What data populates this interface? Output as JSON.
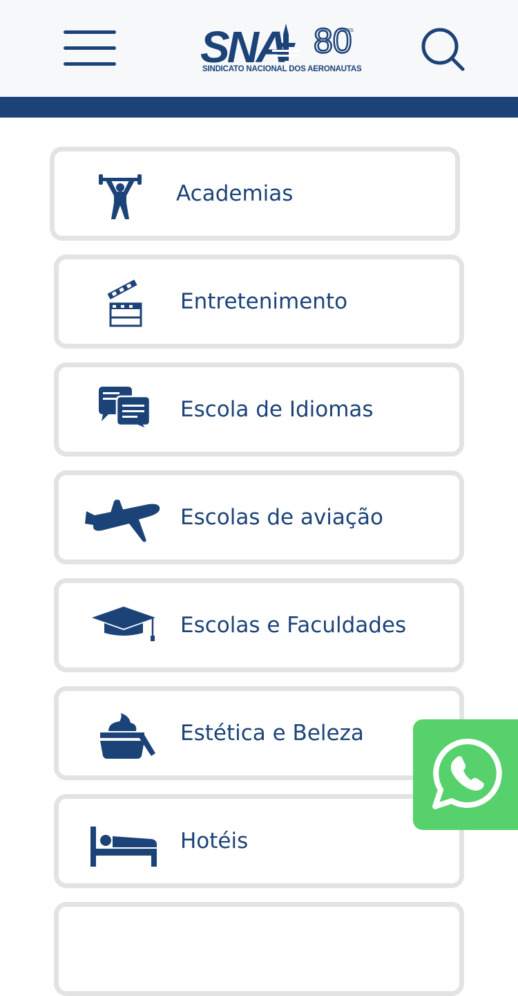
{
  "header": {
    "logo_tagline": "SINDICATO NACIONAL DOS AERONAUTAS",
    "logo_anniversary_label": "ANOS",
    "menu_icon": "hamburger-menu-icon",
    "search_icon": "search-icon"
  },
  "categories": [
    {
      "label": "Academias",
      "icon": "weightlifter-icon"
    },
    {
      "label": "Entretenimento",
      "icon": "clapperboard-icon"
    },
    {
      "label": "Escola de Idiomas",
      "icon": "chat-bubbles-icon"
    },
    {
      "label": "Escolas de aviação",
      "icon": "airplane-icon"
    },
    {
      "label": "Escolas e Faculdades",
      "icon": "graduation-cap-icon"
    },
    {
      "label": "Estética e Beleza",
      "icon": "cream-jar-icon"
    },
    {
      "label": "Hotéis",
      "icon": "bed-icon"
    }
  ],
  "whatsapp": {
    "icon": "whatsapp-icon"
  },
  "colors": {
    "brand_blue": "#1c4378",
    "card_border": "#e3e3e3",
    "header_bg": "#f6f8fa",
    "whatsapp_green": "#57d16b"
  }
}
